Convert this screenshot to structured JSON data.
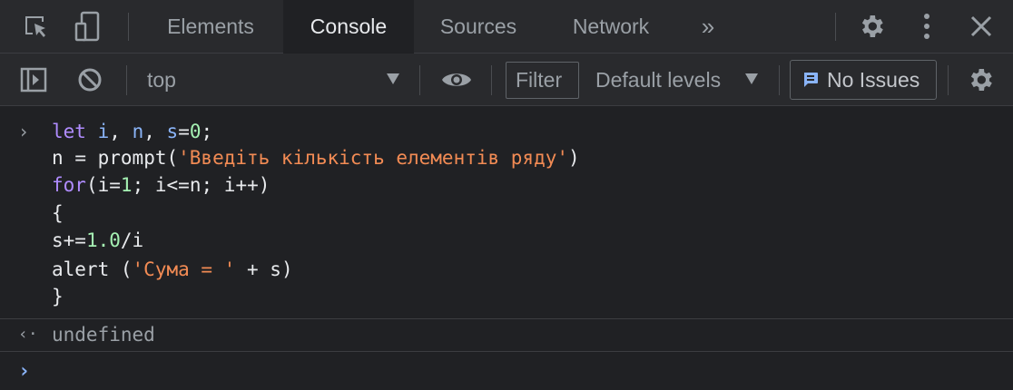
{
  "tabs": {
    "items": [
      "Elements",
      "Console",
      "Sources",
      "Network"
    ],
    "active": "Console",
    "more": "»"
  },
  "toolbar": {
    "context": "top",
    "filter_label": "Filter",
    "levels": "Default levels",
    "issues": "No Issues"
  },
  "console": {
    "input_lines": [
      "let i, n, s=0;",
      "n = prompt('Введіть кількість елементів ряду')",
      "for(i=1; i<=n; i++)",
      "{",
      "s+=1.0/i",
      "alert ('Сума = ' + s)",
      "}"
    ],
    "result": "undefined"
  },
  "colors": {
    "background": "#202124",
    "toolbar": "#292a2d",
    "keyword": "#b08cff",
    "variable": "#8ab4f8",
    "number": "#a5f1b3",
    "string": "#f28b54",
    "accent": "#8ab4f8"
  },
  "icons": [
    "inspect-icon",
    "device-toolbar-icon",
    "more-tabs-icon",
    "settings-icon",
    "kebab-menu-icon",
    "close-icon",
    "sidebar-toggle-icon",
    "clear-console-icon",
    "dropdown-arrow-icon",
    "eye-icon",
    "issues-icon",
    "console-settings-icon",
    "input-prompt-icon",
    "result-arrow-icon"
  ]
}
